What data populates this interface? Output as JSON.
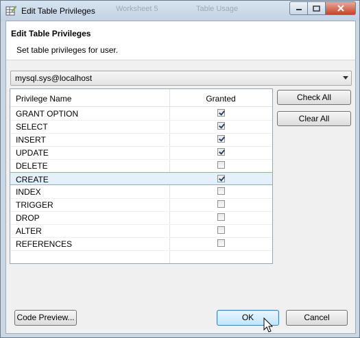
{
  "window": {
    "title": "Edit Table Privileges",
    "background_tabs": [
      "Worksheet 5",
      "Table Usage"
    ]
  },
  "header": {
    "title": "Edit Table Privileges",
    "description": "Set table privileges for user."
  },
  "user_select": {
    "value": "mysql.sys@localhost"
  },
  "table": {
    "columns": [
      "Privilege Name",
      "Granted"
    ],
    "rows": [
      {
        "name": "GRANT OPTION",
        "granted": true
      },
      {
        "name": "SELECT",
        "granted": true
      },
      {
        "name": "INSERT",
        "granted": true
      },
      {
        "name": "UPDATE",
        "granted": true
      },
      {
        "name": "DELETE",
        "granted": false
      },
      {
        "name": "CREATE",
        "granted": true,
        "selected": true
      },
      {
        "name": "INDEX",
        "granted": false
      },
      {
        "name": "TRIGGER",
        "granted": false
      },
      {
        "name": "DROP",
        "granted": false
      },
      {
        "name": "ALTER",
        "granted": false
      },
      {
        "name": "REFERENCES",
        "granted": false
      }
    ]
  },
  "buttons": {
    "check_all": "Check All",
    "clear_all": "Clear All",
    "code_preview": "Code Preview...",
    "ok": "OK",
    "cancel": "Cancel"
  },
  "colors": {
    "title_bar": "#c9d6e4",
    "selected_row": "#e6f0fa",
    "close_button": "#c7432a"
  }
}
